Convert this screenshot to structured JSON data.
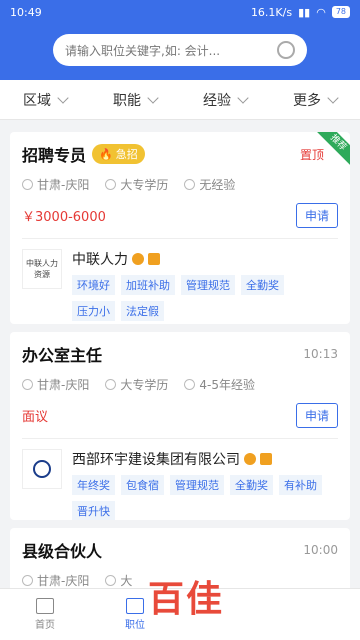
{
  "status": {
    "time": "10:49",
    "speed": "16.1K/s",
    "battery": "78"
  },
  "search": {
    "placeholder": "请输入职位关键字,如: 会计..."
  },
  "filters": [
    "区域",
    "职能",
    "经验",
    "更多"
  ],
  "jobs": [
    {
      "title": "招聘专员",
      "urgent_label": "急招",
      "top_label": "置顶",
      "ribbon": "推荐",
      "location": "甘肃-庆阳",
      "education": "大专学历",
      "experience": "无经验",
      "salary": "￥3000-6000",
      "apply": "申请",
      "company": "中联人力",
      "logo_text": "中联人力资源",
      "tags": [
        "环境好",
        "加班补助",
        "管理规范",
        "全勤奖",
        "压力小",
        "法定假"
      ]
    },
    {
      "title": "办公室主任",
      "time": "10:13",
      "location": "甘肃-庆阳",
      "education": "大专学历",
      "experience": "4-5年经验",
      "salary": "面议",
      "apply": "申请",
      "company": "西部环宇建设集团有限公司",
      "tags": [
        "年终奖",
        "包食宿",
        "管理规范",
        "全勤奖",
        "有补助",
        "晋升快"
      ]
    },
    {
      "title": "县级合伙人",
      "time": "10:00",
      "location": "甘肃-庆阳",
      "education": "大"
    }
  ],
  "nav": {
    "home": "首页",
    "jobs": "职位"
  },
  "watermark": "百佳",
  "colors": {
    "primary": "#3a6ee8",
    "salary": "#e53935",
    "urgent": "#f1c232"
  }
}
